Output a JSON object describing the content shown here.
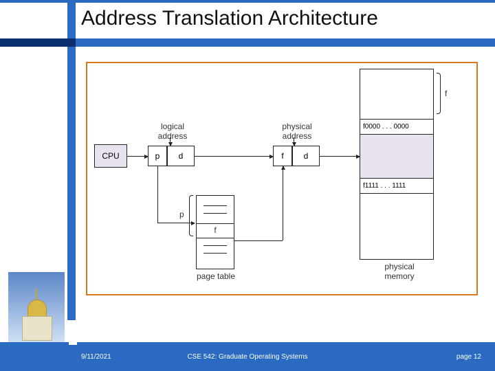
{
  "title": "Address Translation Architecture",
  "diagram": {
    "cpu": "CPU",
    "logical_address": "logical\naddress",
    "physical_address": "physical\naddress",
    "p": "p",
    "d": "d",
    "f": "f",
    "page_table": "page table",
    "physical_memory": "physical\nmemory",
    "frame_top": "f0000 . . . 0000",
    "frame_bottom": "f1111 . . . 1111",
    "brace_f": "f"
  },
  "footer": {
    "date": "9/11/2021",
    "course": "CSE 542: Graduate Operating Systems",
    "page_label": "page 12"
  }
}
